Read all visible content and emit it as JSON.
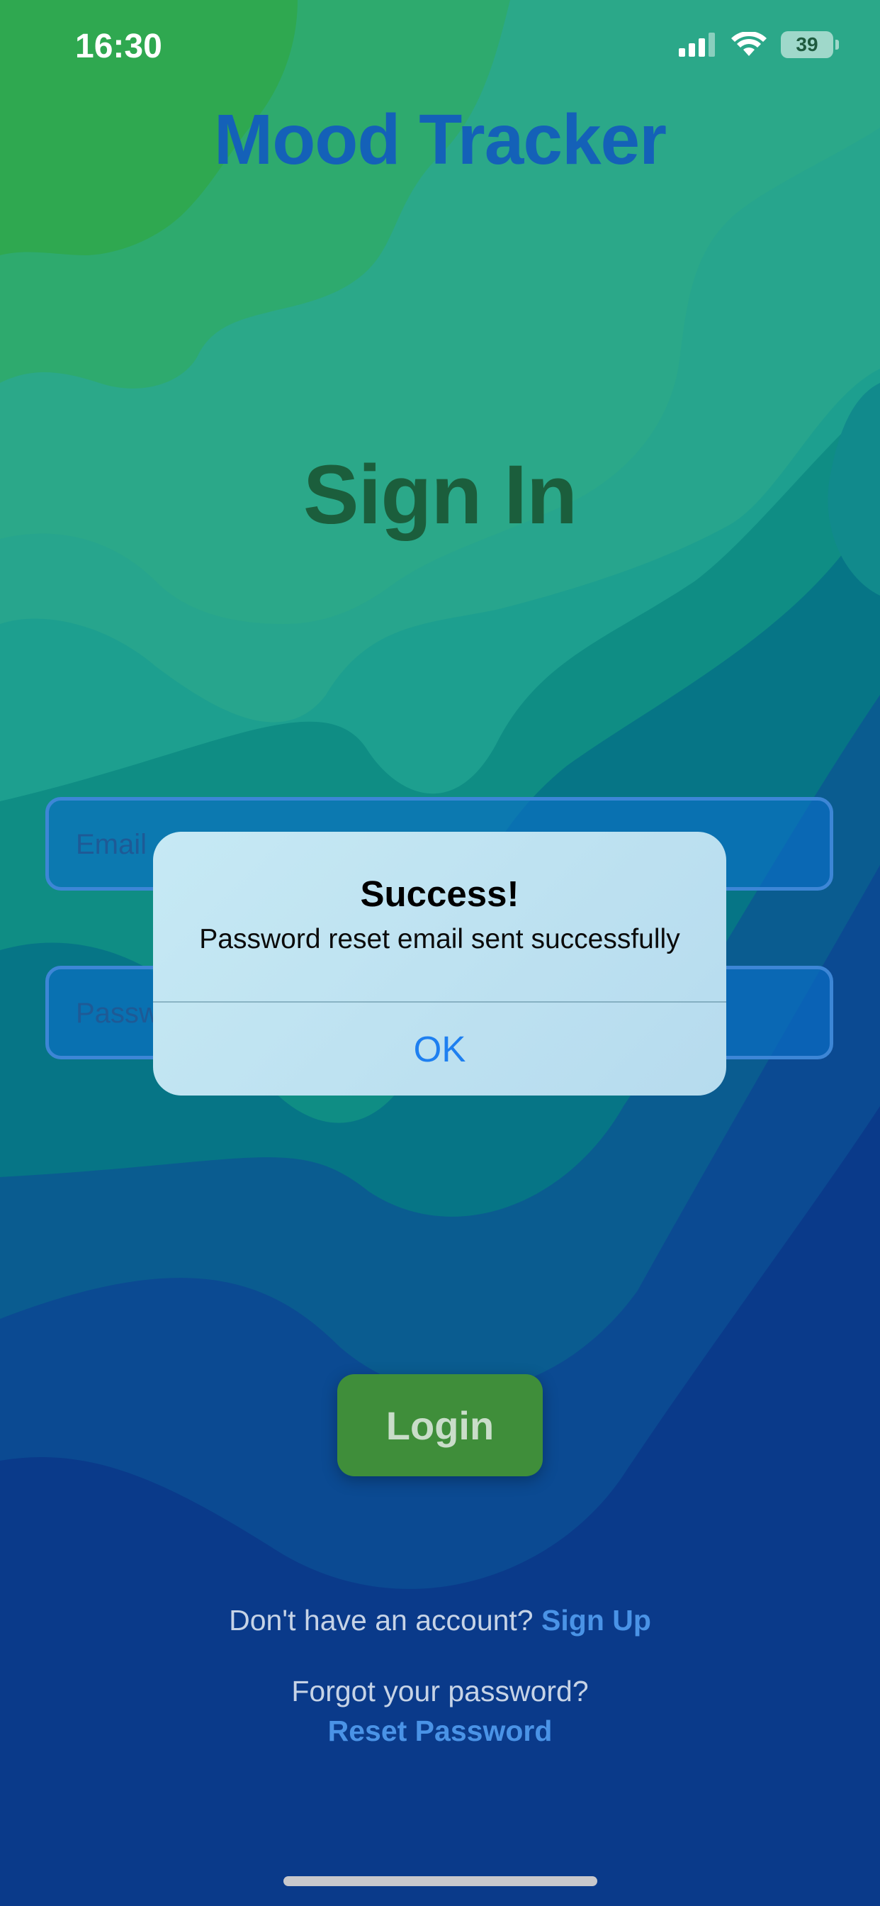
{
  "status_bar": {
    "time": "16:30",
    "battery": "39",
    "icons": [
      "cellular-signal-icon",
      "wifi-icon",
      "battery-icon"
    ]
  },
  "header": {
    "app_title": "Mood Tracker"
  },
  "screen_title": "Sign In",
  "form": {
    "email_placeholder": "Email",
    "password_placeholder": "Password",
    "login_label": "Login"
  },
  "footer": {
    "signup_prompt": "Don't have an account?",
    "signup_link": "Sign Up",
    "forgot_prompt": "Forgot your password?",
    "reset_link": "Reset Password"
  },
  "alert": {
    "title": "Success!",
    "message": "Password reset email sent successfully",
    "ok_label": "OK"
  },
  "colors": {
    "accent_blue": "#1461b8",
    "link_blue": "#4a93e6",
    "login_green": "#3f8e3a",
    "alert_button": "#1e7ff0"
  }
}
